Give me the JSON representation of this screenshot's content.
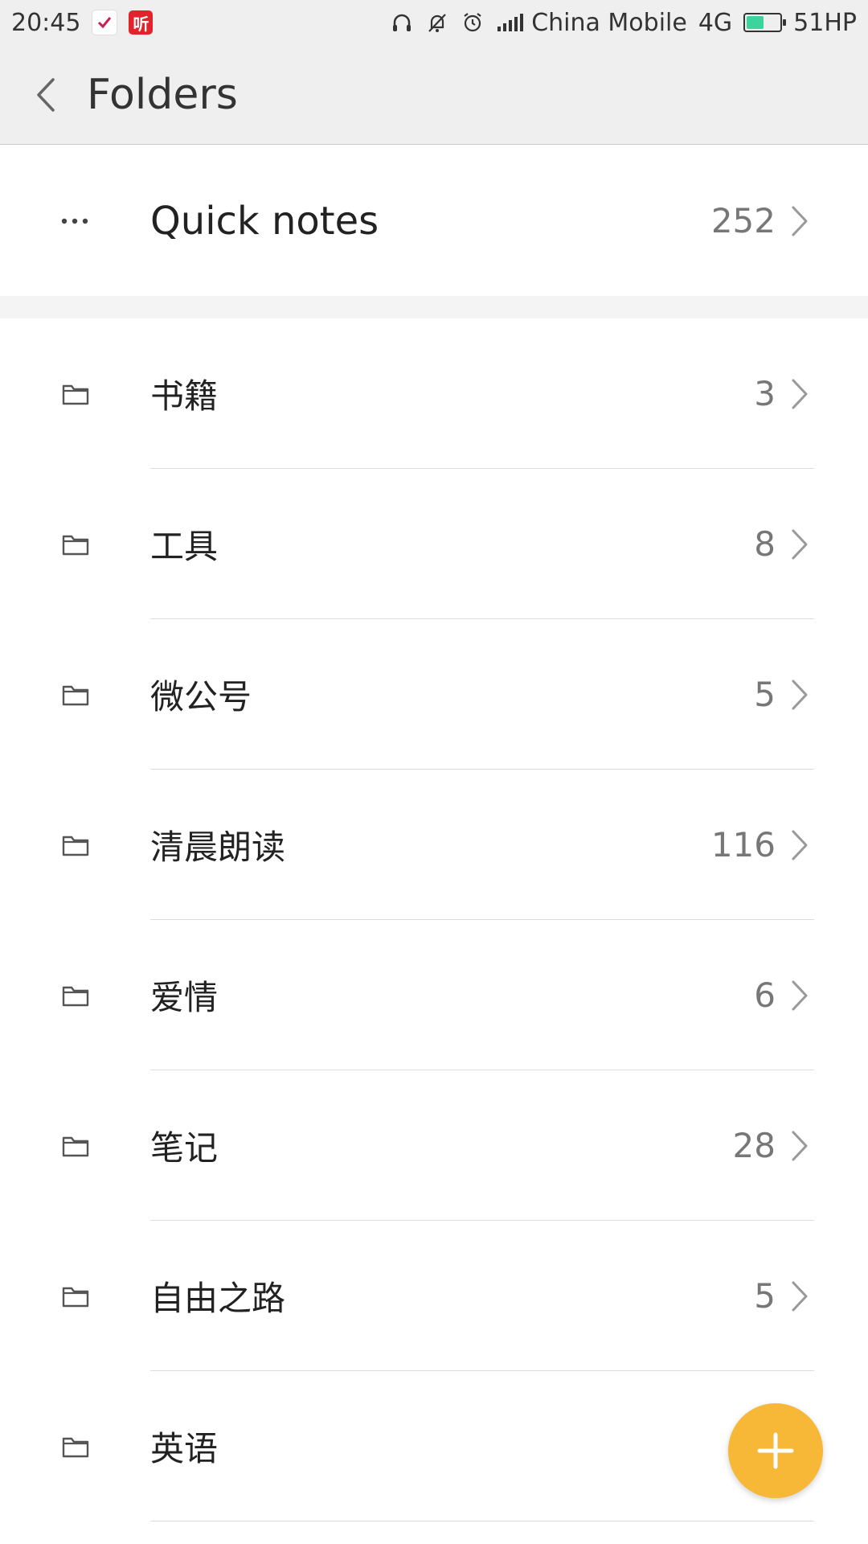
{
  "status_bar": {
    "time": "20:45",
    "app_badge_2": "听",
    "carrier": "China Mobile",
    "network": "4G",
    "battery_text": "51HP",
    "battery_level": 0.51
  },
  "app_bar": {
    "title": "Folders"
  },
  "quick_notes": {
    "label": "Quick notes",
    "count": "252"
  },
  "folders": [
    {
      "name": "书籍",
      "count": "3"
    },
    {
      "name": "工具",
      "count": "8"
    },
    {
      "name": "微公号",
      "count": "5"
    },
    {
      "name": "清晨朗读",
      "count": "116"
    },
    {
      "name": "爱情",
      "count": "6"
    },
    {
      "name": "笔记",
      "count": "28"
    },
    {
      "name": "自由之路",
      "count": "5"
    },
    {
      "name": "英语",
      "count": ""
    }
  ],
  "colors": {
    "fab": "#f7b737",
    "battery": "#3bd49c",
    "header_bg": "#efefef"
  },
  "icons": {
    "back": "chevron-left-icon",
    "quick_notes": "more-horizontal-icon",
    "folder": "folder-icon",
    "row_nav": "chevron-right-icon",
    "fab": "plus-icon"
  }
}
